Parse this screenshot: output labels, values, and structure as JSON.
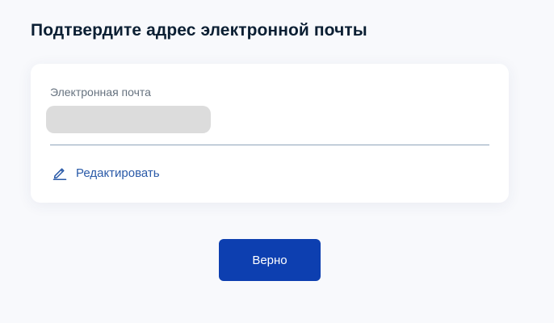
{
  "page": {
    "title": "Подтвердите адрес электронной почты"
  },
  "email_card": {
    "field_label": "Электронная почта",
    "field_value_redacted": true,
    "edit_label": "Редактировать",
    "edit_icon": "pencil-icon"
  },
  "actions": {
    "confirm_label": "Верно"
  },
  "colors": {
    "background": "#f8f9fc",
    "title": "#0b1f33",
    "label": "#66727f",
    "link": "#2a5aa8",
    "primary_button": "#0d3fb0",
    "redaction": "#dcdcdc"
  }
}
